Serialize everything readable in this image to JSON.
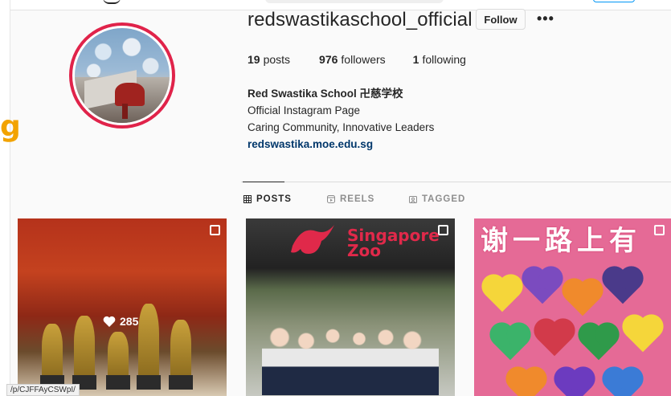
{
  "profile": {
    "username": "redswastikaschool_official",
    "follow_label": "Follow",
    "more_label": "•••",
    "stats": {
      "posts_count": "19",
      "posts_label": "posts",
      "followers_count": "976",
      "followers_label": "followers",
      "following_count": "1",
      "following_label": "following"
    },
    "bio": {
      "name": "Red Swastika School 卍慈学校",
      "line1": "Official Instagram Page",
      "line2": "Caring Community, Innovative Leaders",
      "link": "redswastika.moe.edu.sg"
    }
  },
  "tabs": [
    {
      "label": "POSTS",
      "icon": "grid-icon",
      "active": true
    },
    {
      "label": "REELS",
      "icon": "reels-icon",
      "active": false
    },
    {
      "label": "TAGGED",
      "icon": "tagged-icon",
      "active": false
    }
  ],
  "posts": [
    {
      "description": "trophies",
      "likes": "285",
      "multi": true
    },
    {
      "description": "singapore zoo group photo",
      "sign": "Singapore Zoo",
      "multi": true
    },
    {
      "description": "paper hearts banner",
      "banner": "谢一路上有",
      "multi": true
    }
  ],
  "side_glyph": "g",
  "status_url": "/p/CJFFAyCSWpI/",
  "colors": {
    "avatar_ring": "#e0234a",
    "link": "#00376b",
    "text": "#262626",
    "muted": "#8e8e8e"
  }
}
